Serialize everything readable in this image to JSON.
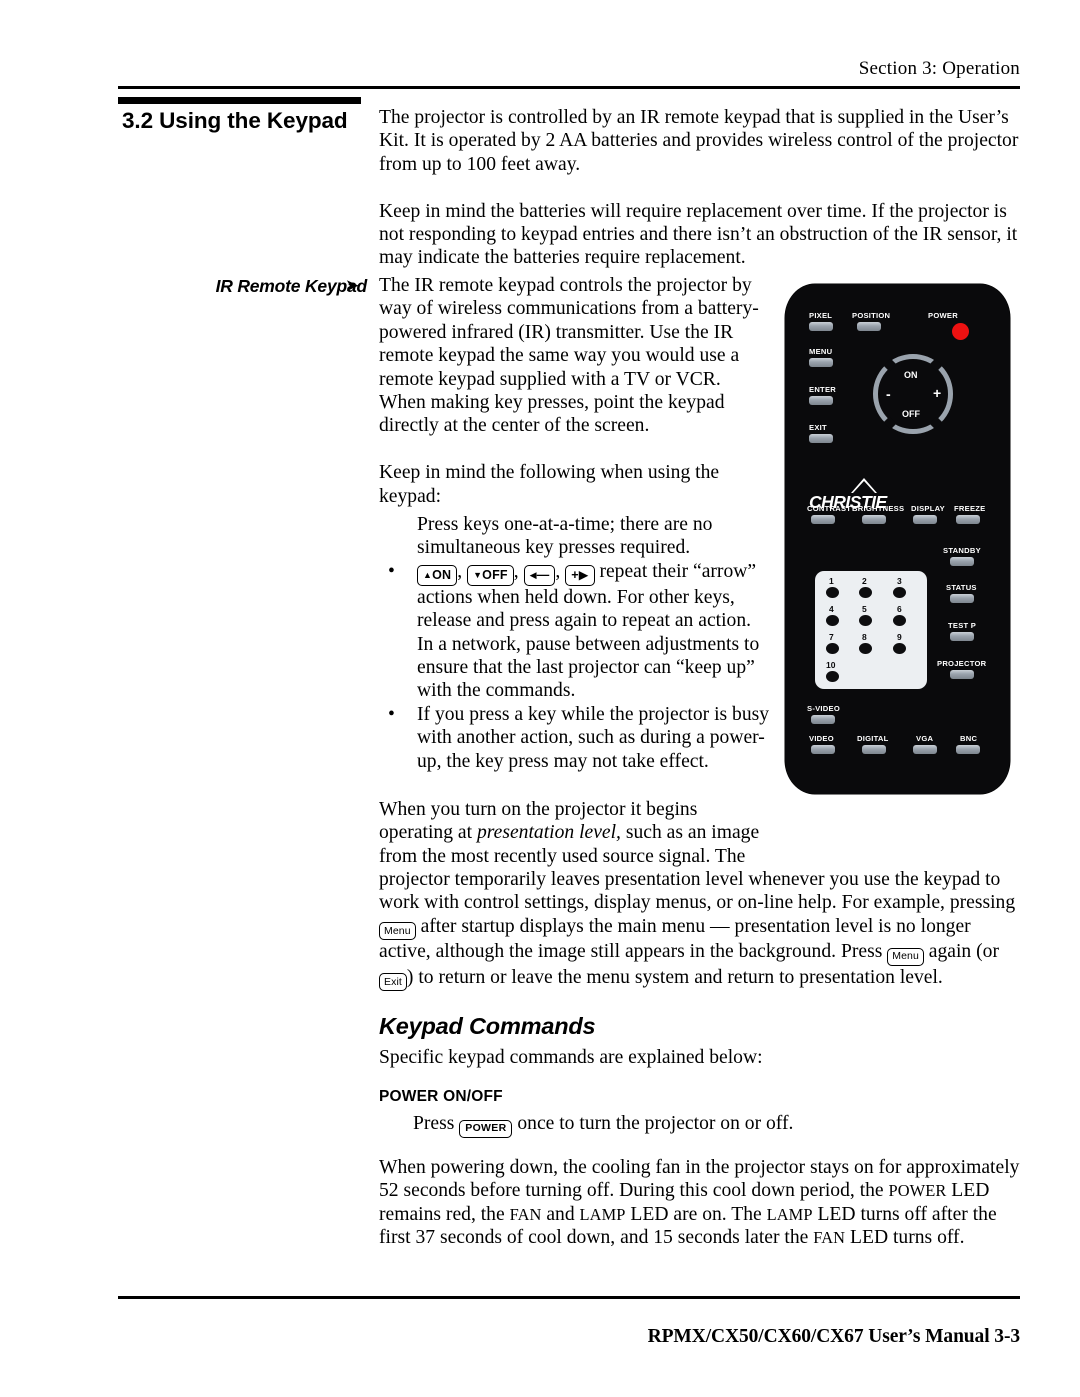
{
  "page": {
    "running_head": "Section 3: Operation",
    "section_number_title": "3.2 Using the Keypad",
    "footer": "RPMX/CX50/CX60/CX67 User’s Manual  3-3"
  },
  "side_head": {
    "label": "IR Remote Keypad",
    "arrow_icon": "➤"
  },
  "intro": {
    "p1": "The projector is controlled by an IR remote keypad that is supplied in the User’s Kit. It is operated by 2 AA batteries and provides wireless control of the projector from up to 100 feet away.",
    "p2": "Keep in mind the batteries will require replacement over time. If the projector is not responding to keypad entries and there isn’t an obstruction of the IR sensor, it may indicate the batteries require replacement."
  },
  "ir_section": {
    "p1": "The IR remote keypad controls the projector by way of wireless communications from a battery-powered infrared (IR) transmitter. Use the IR remote keypad the same way you would use a remote keypad supplied with a TV or VCR. When making key presses, point the keypad directly at the center of the screen.",
    "p2": "Keep in mind the following when using the keypad:"
  },
  "bullets": {
    "bullet_glyph": "•",
    "b1": "Press keys one-at-a-time; there are no simultaneous key presses required.",
    "b2_keys": [
      {
        "name": "power-on-key",
        "tri": "▲",
        "label": "ON"
      },
      {
        "name": "power-off-key",
        "tri": "▼",
        "label": "OFF"
      },
      {
        "name": "minus-left-key",
        "tri": "◀",
        "label": "—"
      },
      {
        "name": "plus-right-key",
        "tri": "",
        "label": "+▶"
      }
    ],
    "b2_text": "repeat their “arrow” actions when held down. For other keys, release and press again to repeat an action. In a network, pause between adjustments to ensure that the last projector can “keep up” with the commands.",
    "b3": "If you press a key while the projector is busy with another action, such as during a power-up, the key press may not take effect."
  },
  "presentation": {
    "seg1": "When you turn on the projector it begins operating at ",
    "italic": "presentation level,",
    "seg2": " such as an image from the most recently used source signal. The projector temporarily leaves presentation level whenever you use the keypad to work with control settings, display menus, or on-line help. For example, pressing ",
    "menu_key": "Menu",
    "seg3": " after startup displays the main menu — presentation level is no longer active, although the image still appears in the background. Press ",
    "menu_key2": "Menu",
    "seg4": " again (or",
    "exit_key": "Exit",
    "seg5": ") to return or leave the menu system and return to presentation level."
  },
  "keypad_commands": {
    "heading": "Keypad Commands",
    "intro": "Specific keypad commands are explained below:",
    "sub_heading": "POWER ON/OFF",
    "press_prefix": "Press ",
    "power_key": "POWER",
    "press_suffix": " once to turn the projector on or off.",
    "cooldown_parts": {
      "a": "When powering down, the cooling fan in the projector stays on for approximately 52 seconds before turning off. During this cool down period, the ",
      "sc1": "POWER",
      "b": " LED remains red, the ",
      "sc2": "FAN",
      "c": " and ",
      "sc3": "LAMP",
      "d": " LED are on. The ",
      "sc4": "LAMP",
      "e": " LED turns off after the first 37 seconds of cool down, and 15 seconds later the ",
      "sc5": "FAN",
      "f": " LED turns off."
    }
  },
  "remote": {
    "brand": "CHRISTIE",
    "power_led_color": "#ee1111",
    "row1": [
      {
        "name": "pixel-button",
        "label": "PIXEL"
      },
      {
        "name": "position-button",
        "label": "POSITION"
      },
      {
        "name": "power-label",
        "label": "POWER"
      }
    ],
    "left_column": [
      {
        "name": "menu-button",
        "label": "MENU"
      },
      {
        "name": "enter-button",
        "label": "ENTER"
      },
      {
        "name": "exit-button",
        "label": "EXIT"
      }
    ],
    "ring": {
      "top": "ON",
      "bottom": "OFF",
      "left": "-",
      "right": "+"
    },
    "function_row": [
      {
        "name": "contrast-button",
        "label": "CONTRAST"
      },
      {
        "name": "brightness-button",
        "label": "BRIGHTNESS"
      },
      {
        "name": "display-button",
        "label": "DISPLAY"
      },
      {
        "name": "freeze-button",
        "label": "FREEZE"
      }
    ],
    "right_column": [
      {
        "name": "standby-button",
        "label": "STANDBY"
      },
      {
        "name": "status-button",
        "label": "STATUS"
      },
      {
        "name": "test-p-button",
        "label": "TEST P"
      },
      {
        "name": "projector-button",
        "label": "PROJECTOR"
      }
    ],
    "numpad": [
      "1",
      "2",
      "3",
      "4",
      "5",
      "6",
      "7",
      "8",
      "9",
      "10"
    ],
    "source_row1": [
      {
        "name": "s-video-button",
        "label": "S-VIDEO"
      }
    ],
    "source_row2": [
      {
        "name": "video-button",
        "label": "VIDEO"
      },
      {
        "name": "digital-button",
        "label": "DIGITAL"
      },
      {
        "name": "vga-button",
        "label": "VGA"
      },
      {
        "name": "bnc-button",
        "label": "BNC"
      }
    ]
  }
}
